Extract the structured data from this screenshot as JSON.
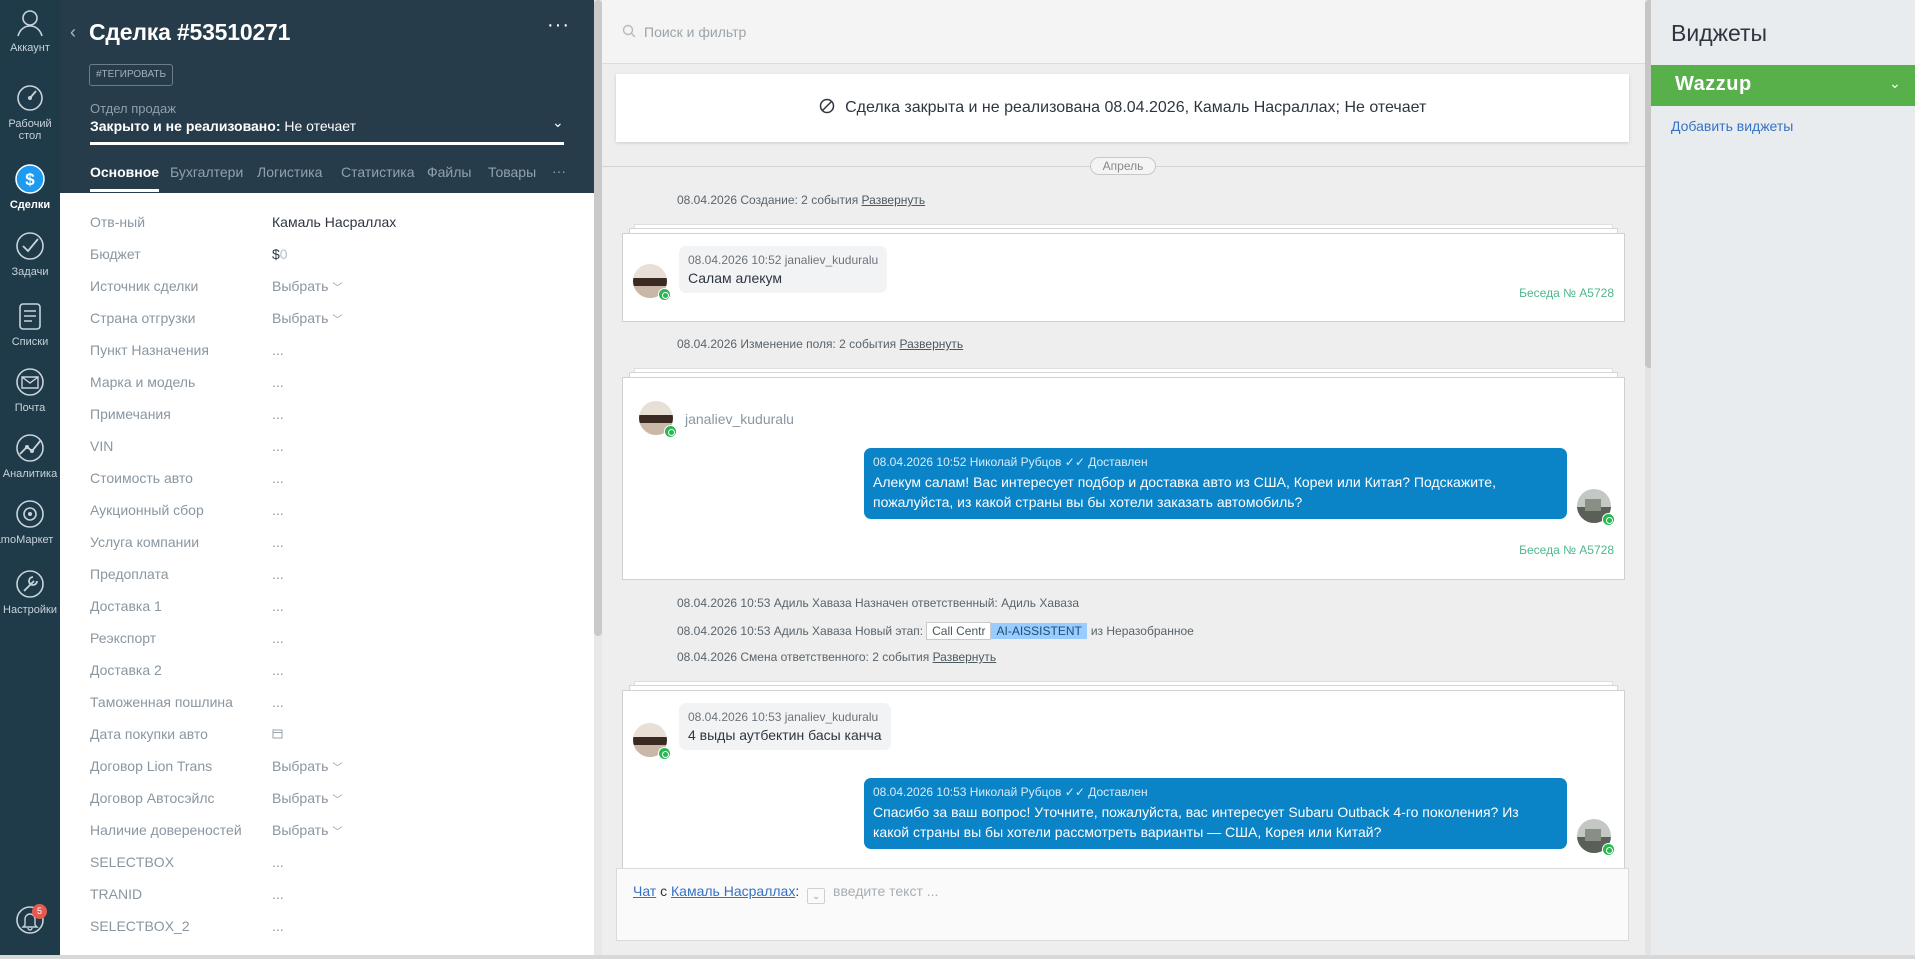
{
  "nav": {
    "account": "Аккаунт",
    "dashboard": "Рабочий стол",
    "deals": "Сделки",
    "tasks": "Задачи",
    "lists": "Списки",
    "mail": "Почта",
    "analytics": "Аналитика",
    "market": "amoМаркет",
    "settings": "Настройки",
    "notif_count": "5"
  },
  "card": {
    "title": "Сделка #53510271",
    "tag_button": "#ТЕГИРОВАТЬ",
    "pipeline": "Отдел продаж",
    "status_bold": "Закрыто и не реализовано:",
    "status_reason": "Не отечает",
    "tabs": [
      "Основное",
      "Бухгалтерия",
      "Логистика",
      "Статистика",
      "Файлы",
      "Товары"
    ],
    "tab_more": "···",
    "fields": [
      {
        "label": "Отв-ный",
        "value": "Камаль Насраллах"
      },
      {
        "label": "Бюджет",
        "value": "$",
        "value2": "0"
      },
      {
        "label": "Источник сделки",
        "value": "Выбрать"
      },
      {
        "label": "Страна отгрузки",
        "value": "Выбрать"
      },
      {
        "label": "Пункт Назначения",
        "value": "..."
      },
      {
        "label": "Марка и модель",
        "value": "..."
      },
      {
        "label": "Примечания",
        "value": "..."
      },
      {
        "label": "VIN",
        "value": "..."
      },
      {
        "label": "Стоимость авто",
        "value": "..."
      },
      {
        "label": "Аукционный сбор",
        "value": "..."
      },
      {
        "label": "Услуга компании",
        "value": "..."
      },
      {
        "label": "Предоплата",
        "value": "..."
      },
      {
        "label": "Доставка 1",
        "value": "..."
      },
      {
        "label": "Реэкспорт",
        "value": "..."
      },
      {
        "label": "Доставка 2",
        "value": "..."
      },
      {
        "label": "Таможенная пошлина",
        "value": "..."
      },
      {
        "label": "Дата покупки авто",
        "value": ""
      },
      {
        "label": "Договор Lion Trans",
        "value": "Выбрать"
      },
      {
        "label": "Договор Автосэйлс",
        "value": "Выбрать"
      },
      {
        "label": "Наличие довереностей",
        "value": "Выбрать"
      },
      {
        "label": "SELECTBOX",
        "value": "..."
      },
      {
        "label": "TRANID",
        "value": "..."
      },
      {
        "label": "SELECTBOX_2",
        "value": "..."
      }
    ]
  },
  "feed": {
    "search_placeholder": "Поиск и фильтр",
    "closed_notice": "Сделка закрыта и не реализована 08.04.2026, Камаль Насраллах; Не отечает",
    "month": "Апрель",
    "event1": "08.04.2026 Создание: 2 события",
    "event_expand": "Развернуть",
    "msg1_meta": "08.04.2026 10:52 janaliev_kuduralu",
    "msg1_text": "Салам алекум",
    "conv_link": "Беседа № A5728",
    "event2": "08.04.2026 Изменение поля: 2 события",
    "chat_user": "janaliev_kuduralu",
    "out1_meta": "08.04.2026 10:52 Николай Рубцов",
    "delivered": "Доставлен",
    "out1_text": "Алекум салам! Вас интересует подбор и доставка авто из США, Кореи или Китая? Подскажите, пожалуйста, из какой страны вы бы хотели заказать автомобиль?",
    "event3": "08.04.2026 10:53 Адиль Хаваза Назначен ответственный: Адиль Хаваза",
    "event4_prefix": "08.04.2026 10:53 Адиль Хаваза Новый этап:",
    "event4_stage": "Call Centr",
    "event4_stage2": "AI-AISSISTENT",
    "event4_suffix": "из Неразобранное",
    "event5": "08.04.2026 Смена ответственного: 2 события",
    "msg2_meta": "08.04.2026 10:53 janaliev_kuduralu",
    "msg2_text": "4 выды аутбектин басы канча",
    "out2_meta": "08.04.2026 10:53 Николай Рубцов",
    "out2_text": "Спасибо за ваш вопрос! Уточните, пожалуйста, вас интересует Subaru Outback 4-го поколения? Из какой страны вы бы хотели рассмотреть варианты — США, Корея или Китай?",
    "compose_chat": "Чат",
    "compose_with": "с",
    "compose_contact": "Камаль Насраллах",
    "compose_colon": ":",
    "compose_placeholder": "введите текст ..."
  },
  "widgets": {
    "title": "Виджеты",
    "wazzup": "Wazzup",
    "add": "Добавить виджеты"
  },
  "colors": {
    "nav_bg": "#1f3a49",
    "card_head": "#273c4a",
    "out_bubble": "#0a83c7",
    "wazzup_green": "#57b04a",
    "link": "#3572c4"
  }
}
